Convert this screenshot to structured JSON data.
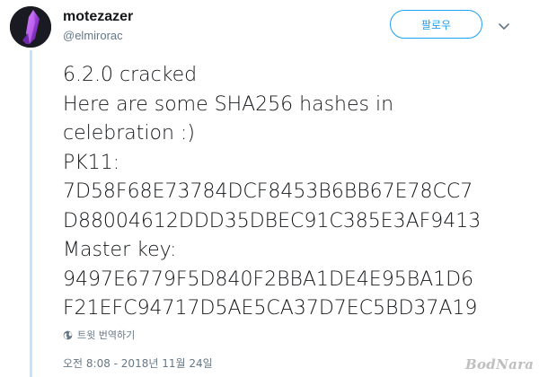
{
  "author": {
    "display_name": "motezazer",
    "handle": "@elmirorac"
  },
  "follow_button": {
    "label": "팔로우"
  },
  "tweet": {
    "lines": [
      "6.2.0 cracked",
      "Here are some SHA256 hashes in",
      "celebration :)",
      "PK11:",
      "7D58F68E73784DCF8453B6BB67E78CC7",
      "D88004612DDD35DBEC91C385E3AF9413",
      "Master key:",
      "9497E6779F5D840F2BBA1DE4E95BA1D6",
      "F21EFC94717D5AE5CA37D7EC5BD37A19"
    ]
  },
  "translate": {
    "label": "트윗 번역하기"
  },
  "timestamp": "오전 8:08 - 2018년 11월 24일",
  "watermark": "BodNara",
  "colors": {
    "accent": "#1da1f2",
    "muted_text": "#657786",
    "thread_line": "#c4e4f7",
    "avatar_bg": "#1a1b22",
    "avatar_crystal": "#9b3fd6"
  },
  "icons": {
    "caret": "chevron-down-icon",
    "translate": "globe-icon",
    "avatar_art": "purple-crystal"
  }
}
